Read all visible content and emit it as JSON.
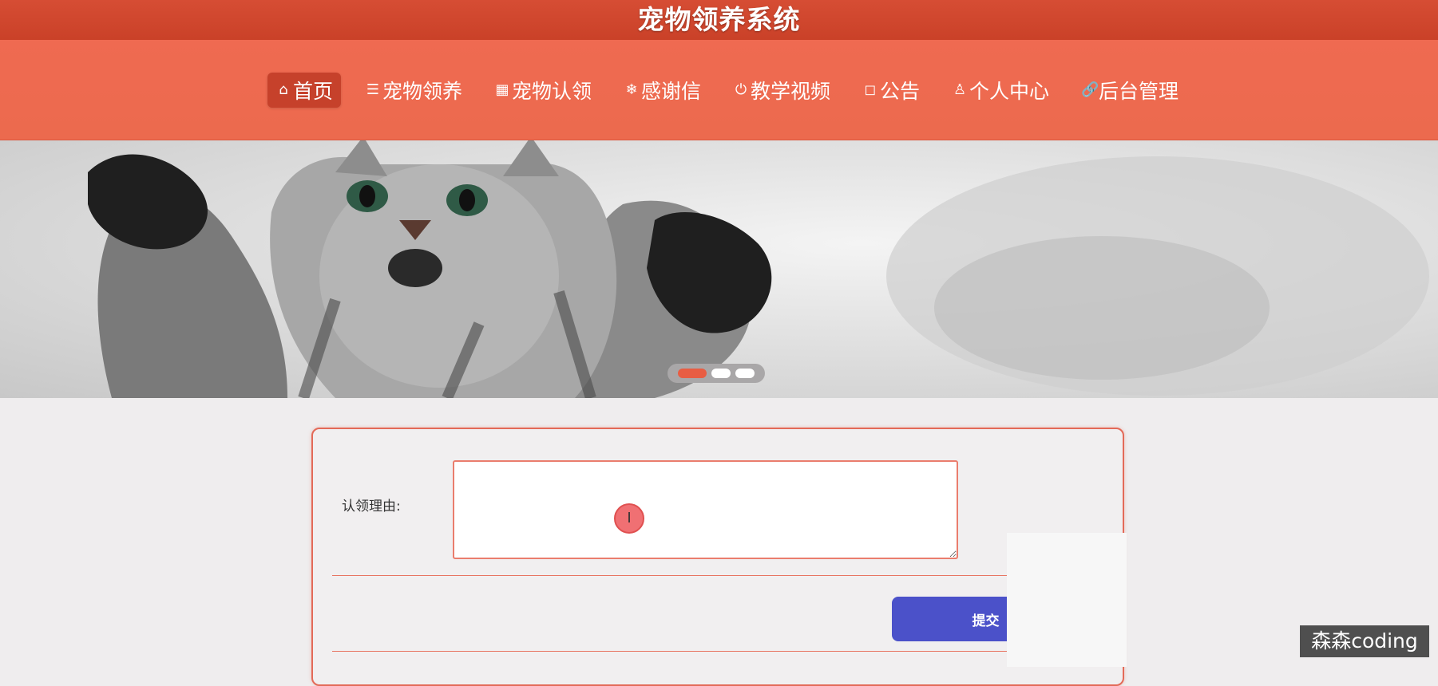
{
  "header": {
    "title": "宠物领养系统"
  },
  "nav": {
    "items": [
      {
        "icon": "⌂",
        "label": "首页"
      },
      {
        "icon": "☰",
        "label": "宠物领养"
      },
      {
        "icon": "▦",
        "label": "宠物认领"
      },
      {
        "icon": "❄",
        "label": "感谢信"
      },
      {
        "icon": "⏻",
        "label": "教学视频"
      },
      {
        "icon": "◻",
        "label": "公告"
      },
      {
        "icon": "♙",
        "label": "个人中心"
      },
      {
        "icon": "🔗",
        "label": "后台管理"
      }
    ]
  },
  "carousel": {
    "slide_count": 3,
    "active_index": 0
  },
  "form": {
    "reason_label": "认领理由:",
    "reason_value": "",
    "submit_label": "提交"
  },
  "watermark": "森森coding",
  "colors": {
    "header": "#ca4128",
    "nav": "#ec6a4e",
    "active_nav": "#c6412b",
    "submit": "#4b51c9",
    "panel_border": "#e36a58"
  }
}
